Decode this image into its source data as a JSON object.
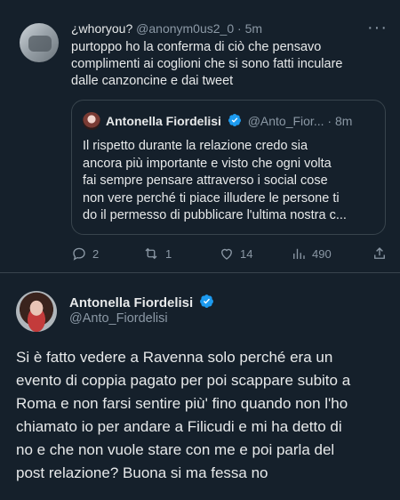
{
  "reply_tweet": {
    "display_name": "¿whoryou?",
    "handle": "@anonym0us2_0",
    "time": "5m",
    "more": "···",
    "text_lines": [
      "purtoppo ho la conferma di ciò che pensavo",
      "complimenti ai coglioni che si sono fatti inculare",
      "dalle canzoncine e dai tweet"
    ],
    "quoted": {
      "display_name": "Antonella Fiordelisi",
      "handle": "@Anto_Fior...",
      "time": "8m",
      "text_lines": [
        "Il rispetto durante la relazione credo sia",
        "ancora più importante e visto che ogni volta",
        "fai sempre pensare attraverso i social cose",
        "non vere perché ti piace illudere le persone ti",
        "do il permesso di pubblicare l'ultima nostra c..."
      ]
    },
    "actions": {
      "replies": "2",
      "retweets": "1",
      "likes": "14",
      "views": "490"
    }
  },
  "main_tweet": {
    "display_name": "Antonella Fiordelisi",
    "handle": "@Anto_Fiordelisi",
    "text_lines": [
      "Si è fatto vedere a Ravenna solo perché era un",
      "evento di coppia pagato per poi scappare subito a",
      "Roma e non farsi sentire più' fino quando non l'ho",
      "chiamato io per andare a Filicudi e mi ha detto di",
      "no e che non vuole stare con me e poi parla del",
      "post relazione? Buona si ma fessa no"
    ]
  },
  "colors": {
    "background": "#15202b",
    "text": "#e7e9ea",
    "secondary_text": "#8b98a5",
    "border": "#38444d",
    "verified": "#1d9bf0"
  },
  "icons": [
    "reply-icon",
    "retweet-icon",
    "like-icon",
    "views-icon",
    "share-icon",
    "verified-badge-icon",
    "more-icon"
  ]
}
